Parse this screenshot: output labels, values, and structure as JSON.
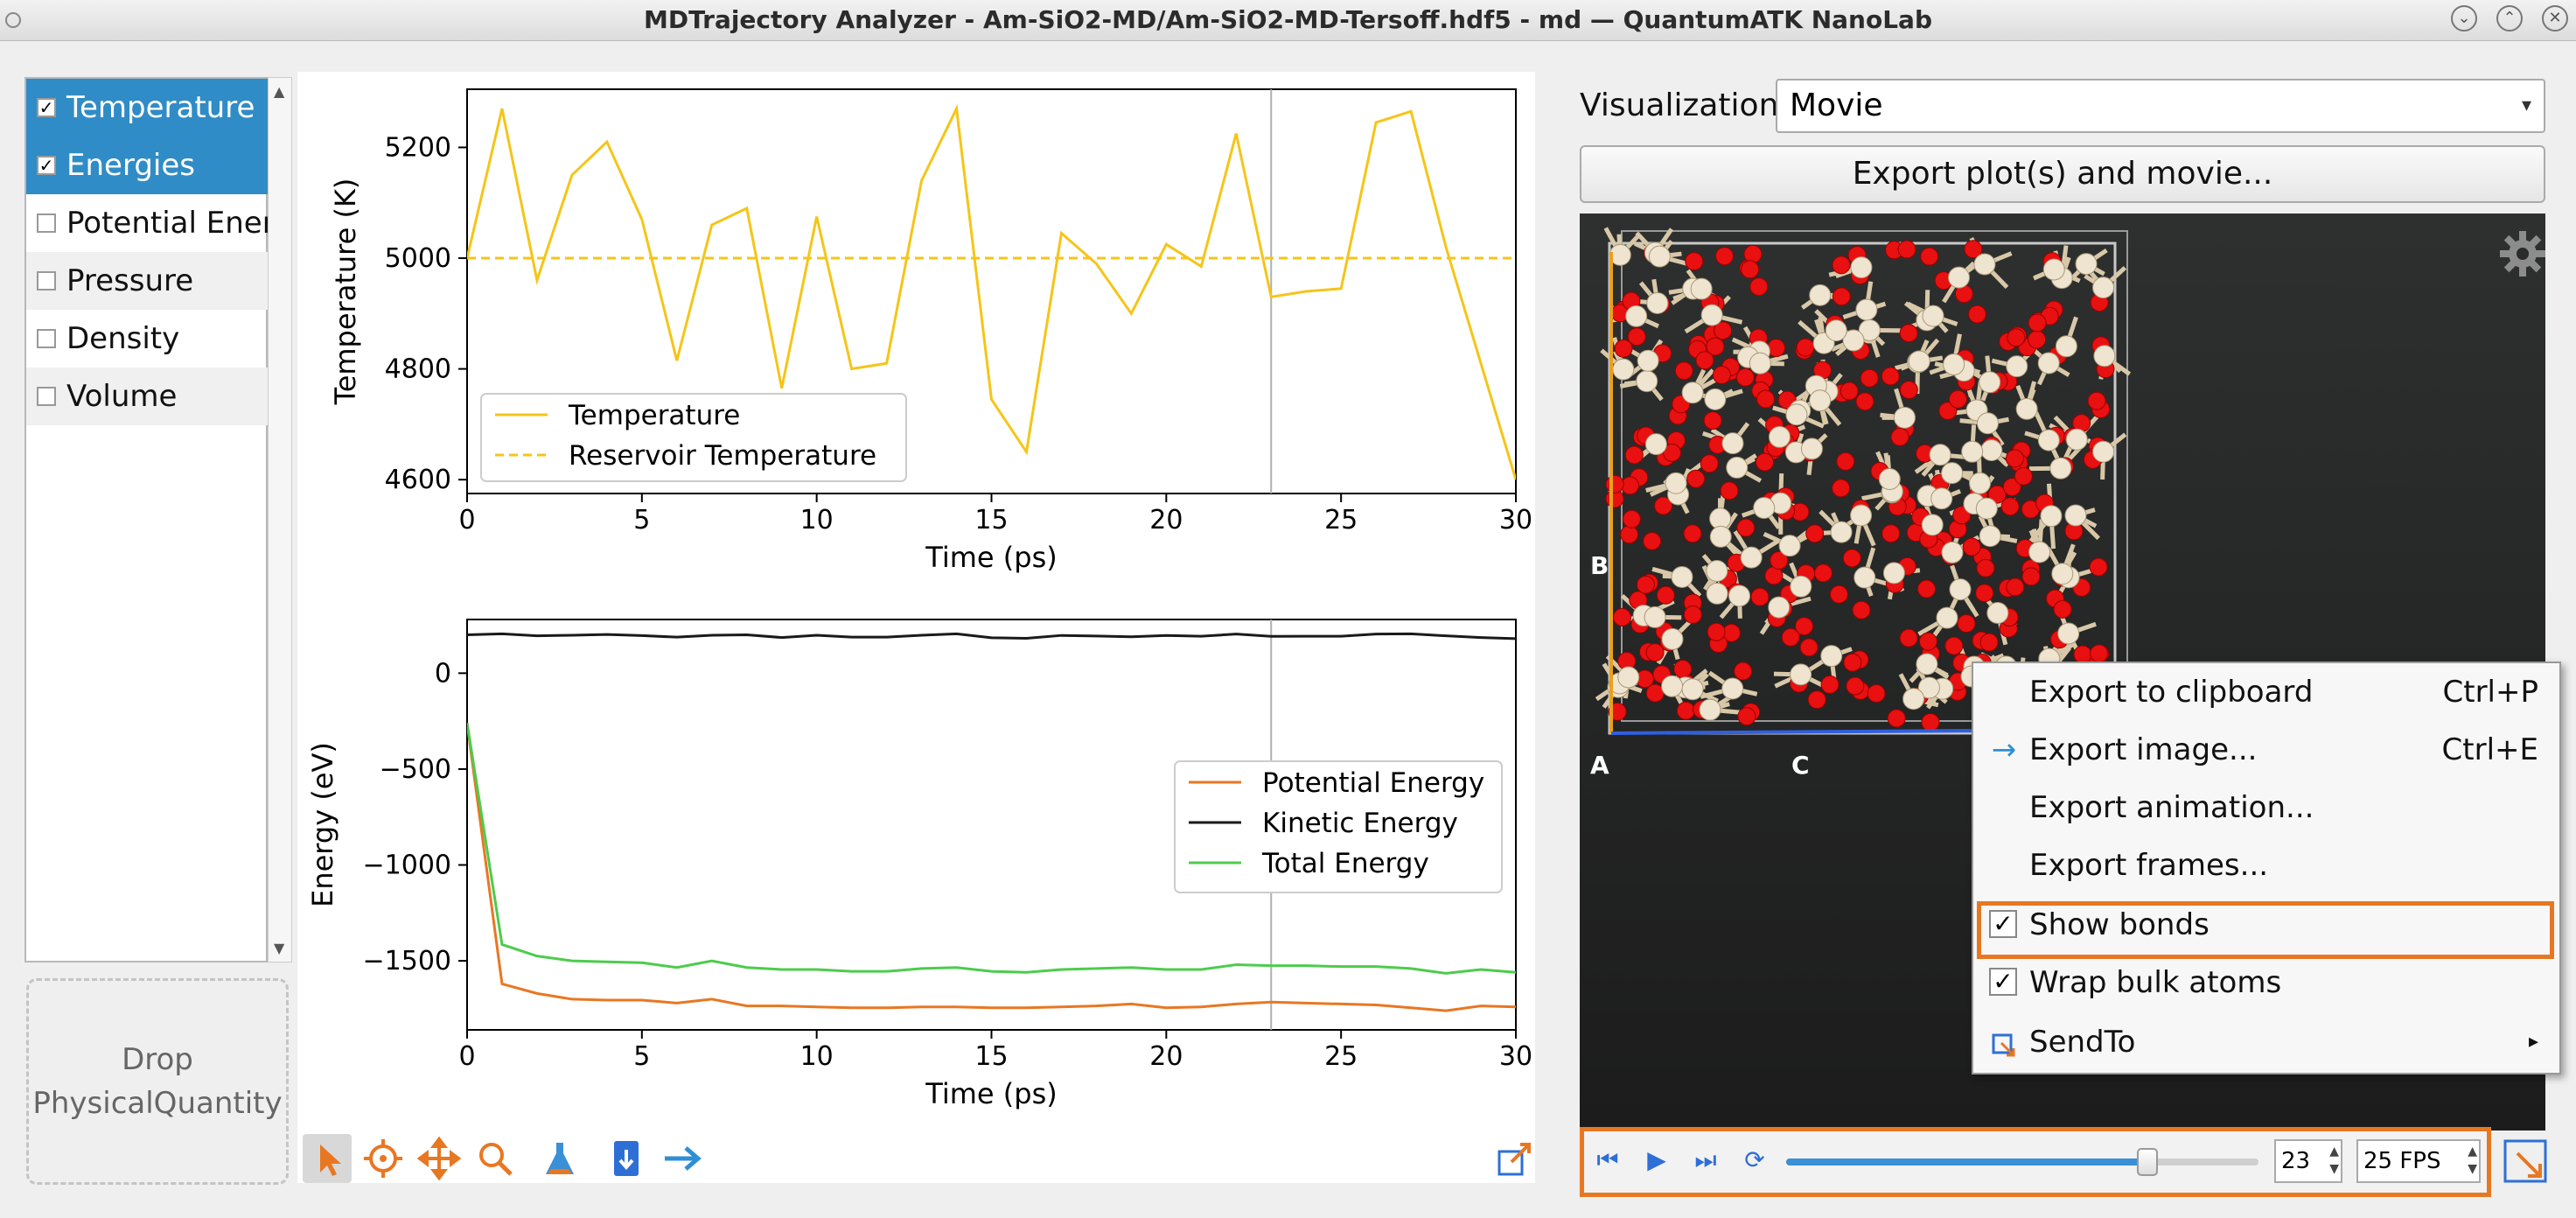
{
  "window": {
    "title": "MDTrajectory Analyzer - Am-SiO2-MD/Am-SiO2-MD-Tersoff.hdf5 - md — QuantumATK NanoLab"
  },
  "quantities": [
    {
      "label": "Temperature",
      "checked": true,
      "selected": true
    },
    {
      "label": "Energies",
      "checked": true,
      "selected": true
    },
    {
      "label": "Potential Energy",
      "checked": false,
      "selected": false
    },
    {
      "label": "Pressure",
      "checked": false,
      "selected": false
    },
    {
      "label": "Density",
      "checked": false,
      "selected": false
    },
    {
      "label": "Volume",
      "checked": false,
      "selected": false
    }
  ],
  "drop_zone": {
    "line1": "Drop",
    "line2": "PhysicalQuantity"
  },
  "colors": {
    "temperature": "#f5c518",
    "potential": "#e87722",
    "kinetic": "#1a1a1a",
    "total": "#4ccc4c",
    "highlight": "#e87722",
    "selection": "#308cc6",
    "cursor": "#b0b0b0"
  },
  "chart_data": [
    {
      "type": "line",
      "xlabel": "Time (ps)",
      "ylabel": "Temperature (K)",
      "xlim": [
        0,
        30
      ],
      "ylim": [
        4575,
        5305
      ],
      "xticks": [
        "0",
        "5",
        "10",
        "15",
        "20",
        "25",
        "30"
      ],
      "yticks": [
        "4600",
        "4800",
        "5000",
        "5200"
      ],
      "legend_position": "bottom-left",
      "cursor_x": 23,
      "x": [
        0,
        1,
        2,
        3,
        4,
        5,
        6,
        7,
        8,
        9,
        10,
        11,
        12,
        13,
        14,
        15,
        16,
        17,
        18,
        19,
        20,
        21,
        22,
        23,
        24,
        25,
        26,
        27,
        28,
        29,
        30
      ],
      "series": [
        {
          "name": "Temperature",
          "style": "solid",
          "values": [
            5000,
            5270,
            4960,
            5150,
            5210,
            5070,
            4815,
            5060,
            5090,
            4765,
            5075,
            4800,
            4810,
            5140,
            5270,
            4745,
            4650,
            5045,
            4990,
            4900,
            5025,
            4985,
            5225,
            4930,
            4940,
            4945,
            5245,
            5265,
            5020,
            4810,
            4600
          ]
        },
        {
          "name": "Reservoir Temperature",
          "style": "dashed",
          "values": [
            5000,
            5000,
            5000,
            5000,
            5000,
            5000,
            5000,
            5000,
            5000,
            5000,
            5000,
            5000,
            5000,
            5000,
            5000,
            5000,
            5000,
            5000,
            5000,
            5000,
            5000,
            5000,
            5000,
            5000,
            5000,
            5000,
            5000,
            5000,
            5000,
            5000,
            5000
          ]
        }
      ]
    },
    {
      "type": "line",
      "xlabel": "Time (ps)",
      "ylabel": "Energy (eV)",
      "xlim": [
        0,
        30
      ],
      "ylim": [
        -1860,
        280
      ],
      "xticks": [
        "0",
        "5",
        "10",
        "15",
        "20",
        "25",
        "30"
      ],
      "yticks": [
        "0",
        "−500",
        "−1000",
        "−1500"
      ],
      "legend_position": "center-right",
      "cursor_x": 23,
      "x": [
        0,
        1,
        2,
        3,
        4,
        5,
        6,
        7,
        8,
        9,
        10,
        11,
        12,
        13,
        14,
        15,
        16,
        17,
        18,
        19,
        20,
        21,
        22,
        23,
        24,
        25,
        26,
        27,
        28,
        29,
        30
      ],
      "series": [
        {
          "name": "Potential Energy",
          "style": "solid",
          "values": [
            -260,
            -1620,
            -1670,
            -1700,
            -1705,
            -1705,
            -1720,
            -1700,
            -1735,
            -1735,
            -1740,
            -1745,
            -1745,
            -1740,
            -1740,
            -1745,
            -1745,
            -1740,
            -1735,
            -1725,
            -1745,
            -1740,
            -1725,
            -1715,
            -1720,
            -1725,
            -1730,
            -1745,
            -1760,
            -1735,
            -1740
          ]
        },
        {
          "name": "Kinetic Energy",
          "style": "solid",
          "values": [
            200,
            205,
            195,
            198,
            202,
            196,
            188,
            198,
            200,
            186,
            198,
            188,
            188,
            198,
            205,
            185,
            182,
            197,
            194,
            190,
            197,
            193,
            204,
            192,
            193,
            193,
            204,
            205,
            195,
            186,
            180
          ]
        },
        {
          "name": "Total Energy",
          "style": "solid",
          "values": [
            -260,
            -1415,
            -1475,
            -1500,
            -1505,
            -1510,
            -1535,
            -1500,
            -1535,
            -1545,
            -1545,
            -1555,
            -1555,
            -1540,
            -1535,
            -1555,
            -1560,
            -1545,
            -1540,
            -1535,
            -1545,
            -1545,
            -1520,
            -1525,
            -1525,
            -1530,
            -1530,
            -1540,
            -1565,
            -1545,
            -1560
          ]
        }
      ]
    }
  ],
  "plot_toolbar": [
    {
      "icon": "pointer-icon"
    },
    {
      "icon": "crosshair-icon"
    },
    {
      "icon": "pan-icon"
    },
    {
      "icon": "zoom-icon"
    },
    {
      "icon": "flask-icon"
    },
    {
      "icon": "save-data-icon"
    },
    {
      "icon": "send-arrow-icon"
    },
    {
      "icon": "popout-icon"
    }
  ],
  "visualization": {
    "label": "Visualization",
    "value": "Movie",
    "export_button": "Export plot(s) and movie..."
  },
  "viewer": {
    "axis_a": "A",
    "axis_b": "B",
    "axis_c": "C"
  },
  "context_menu": {
    "items": [
      {
        "label": "Export to clipboard",
        "shortcut": "Ctrl+P"
      },
      {
        "label": "Export image...",
        "shortcut": "Ctrl+E",
        "icon": "arrow-right-icon"
      },
      {
        "label": "Export animation...",
        "shortcut": ""
      },
      {
        "label": "Export frames...",
        "shortcut": ""
      },
      {
        "label": "Show bonds",
        "checked": true,
        "highlighted": true
      },
      {
        "label": "Wrap bulk atoms",
        "checked": true
      },
      {
        "label": "SendTo",
        "submenu": true
      }
    ]
  },
  "playback": {
    "frame": "23",
    "fps": "25 FPS",
    "progress": 0.765
  }
}
